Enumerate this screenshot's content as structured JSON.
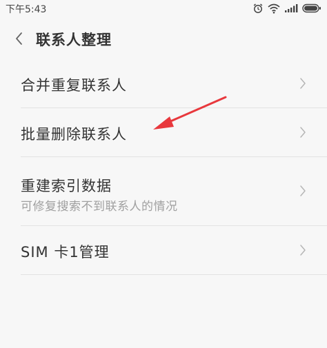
{
  "status_bar": {
    "time": "下午5:43",
    "icons": [
      "alarm-icon",
      "wifi-icon",
      "signal-icon",
      "battery-icon"
    ]
  },
  "header": {
    "title": "联系人整理",
    "back_icon": "chevron-left-icon"
  },
  "list": {
    "items": [
      {
        "title": "合并重复联系人"
      },
      {
        "title": "批量删除联系人"
      },
      {
        "title": "重建索引数据",
        "subtitle": "可修复搜索不到联系人的情况"
      },
      {
        "title": "SIM 卡1管理"
      }
    ]
  },
  "colors": {
    "background": "#f7f7f7",
    "text_primary": "#333333",
    "text_secondary": "#a0a0a0",
    "divider": "#e2e2e2",
    "annotation_arrow": "#e8383d"
  }
}
